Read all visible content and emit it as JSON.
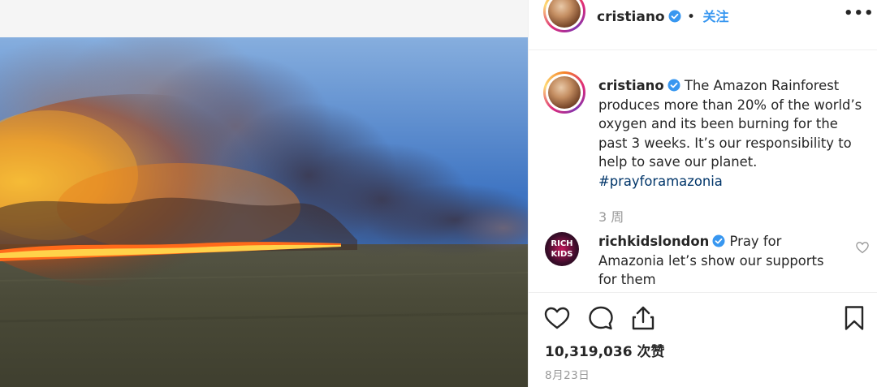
{
  "post": {
    "image_alt": "Amazon rainforest wildfire with smoke plume over grassland"
  },
  "header": {
    "username": "cristiano",
    "separator": "•",
    "follow_label": "关注",
    "more_label": "•••"
  },
  "caption": {
    "username": "cristiano",
    "text": "The Amazon Rainforest produces more than 20% of the world’s oxygen and its been burning for the past 3 weeks. It’s our responsibility to help to save our planet.",
    "hashtag": "#prayforamazonia",
    "time_ago": "3 周"
  },
  "comment": {
    "avatar_text": "RICH KIDS",
    "username": "richkidslondon",
    "text": "Pray for Amazonia let’s show our supports for them"
  },
  "stats": {
    "likes": "10,319,036 次赞",
    "date": "8月23日"
  },
  "colors": {
    "accent": "#3897f0",
    "verified": "#3897f0",
    "hashtag": "#003569",
    "muted": "#999999",
    "text": "#262626"
  },
  "icons": {
    "like": "heart-icon",
    "comment": "comment-icon",
    "share": "share-icon",
    "save": "bookmark-icon",
    "more": "more-icon",
    "verified": "verified-badge-icon"
  }
}
